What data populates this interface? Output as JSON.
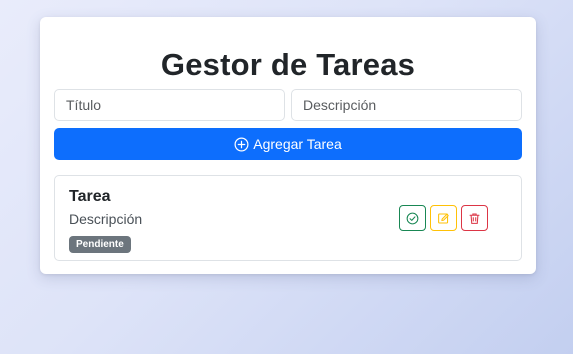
{
  "header": {
    "title": "Gestor de Tareas"
  },
  "form": {
    "title_placeholder": "Título",
    "title_value": "",
    "description_placeholder": "Descripción",
    "description_value": "",
    "add_label": "Agregar Tarea",
    "add_icon": "plus-circle-icon"
  },
  "tasks": [
    {
      "title": "Tarea",
      "description": "Descripción",
      "status": "Pendiente",
      "actions": [
        {
          "icon": "check-circle-icon",
          "color": "#198754"
        },
        {
          "icon": "edit-icon",
          "color": "#ffc107"
        },
        {
          "icon": "trash-icon",
          "color": "#dc3545"
        }
      ]
    }
  ],
  "colors": {
    "primary": "#0d6efd",
    "success": "#198754",
    "warning": "#ffc107",
    "danger": "#dc3545",
    "badge": "#6c757d"
  }
}
